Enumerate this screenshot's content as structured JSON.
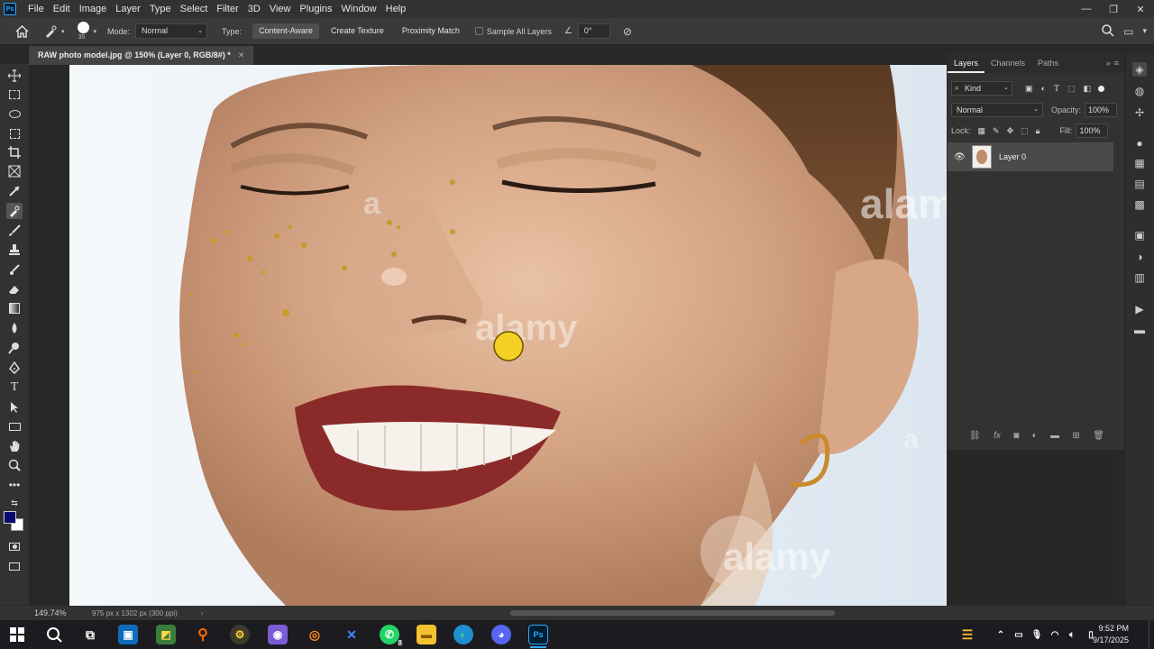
{
  "menu": {
    "logo": "Ps",
    "items": [
      "File",
      "Edit",
      "Image",
      "Layer",
      "Type",
      "Select",
      "Filter",
      "3D",
      "View",
      "Plugins",
      "Window",
      "Help"
    ]
  },
  "options": {
    "brush_size": "35",
    "mode_label": "Mode:",
    "mode_value": "Normal",
    "type_label": "Type:",
    "type_buttons": [
      "Content-Aware",
      "Create Texture",
      "Proximity Match"
    ],
    "sample_all_layers": "Sample All Layers",
    "angle": "0°"
  },
  "document": {
    "tab_title": "RAW photo model.jpg @ 150% (Layer 0, RGB/8#) *",
    "watermark": "alamy",
    "watermark_short": "a"
  },
  "layers_panel": {
    "tabs": [
      "Layers",
      "Channels",
      "Paths"
    ],
    "filter_kind": "Kind",
    "blend_mode": "Normal",
    "opacity_label": "Opacity:",
    "opacity_value": "100%",
    "lock_label": "Lock:",
    "fill_label": "Fill:",
    "fill_value": "100%",
    "layers": [
      {
        "name": "Layer 0",
        "visible": true
      }
    ]
  },
  "status": {
    "zoom": "149.74%",
    "doc_info": "975 px x 1302 px (300 ppi)"
  },
  "taskbar": {
    "whatsapp_badge": "8",
    "time": "9:52 PM",
    "date": "9/17/2025"
  },
  "colors": {
    "accent": "#31a8ff",
    "foreground": "#0b0b6e",
    "background": "#ffffff",
    "brush_cursor": "#f2d024"
  }
}
